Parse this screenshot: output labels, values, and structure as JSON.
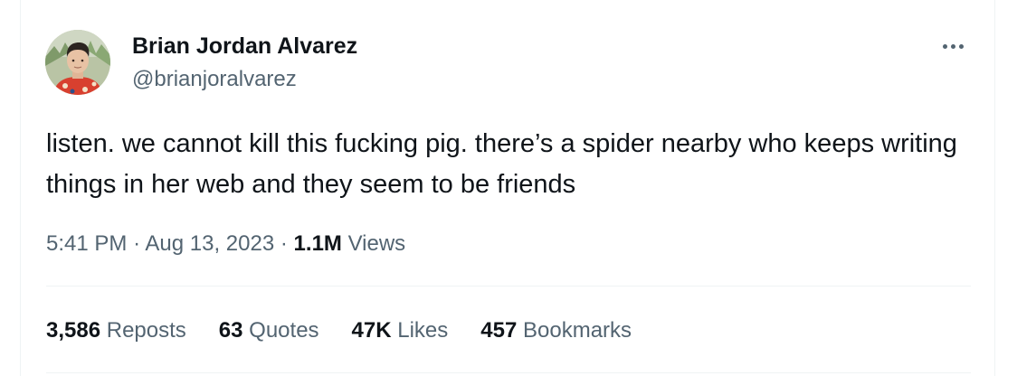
{
  "author": {
    "name": "Brian Jordan Alvarez",
    "handle": "@brianjoralvarez",
    "avatar_icon": "profile-photo"
  },
  "more_icon": "more-horizontal-icon",
  "tweet": {
    "text": "listen. we cannot kill this fucking pig. there’s a spider nearby who keeps writing things in her web and they seem to be friends",
    "time": "5:41 PM",
    "sep1": "·",
    "date": "Aug 13, 2023",
    "sep2": "·",
    "views_count": "1.1M",
    "views_label": "Views"
  },
  "stats": {
    "reposts": {
      "count": "3,586",
      "label": "Reposts"
    },
    "quotes": {
      "count": "63",
      "label": "Quotes"
    },
    "likes": {
      "count": "47K",
      "label": "Likes"
    },
    "bookmarks": {
      "count": "457",
      "label": "Bookmarks"
    }
  },
  "colors": {
    "text_primary": "#0f1419",
    "text_secondary": "#536471",
    "divider": "#eff3f4"
  }
}
